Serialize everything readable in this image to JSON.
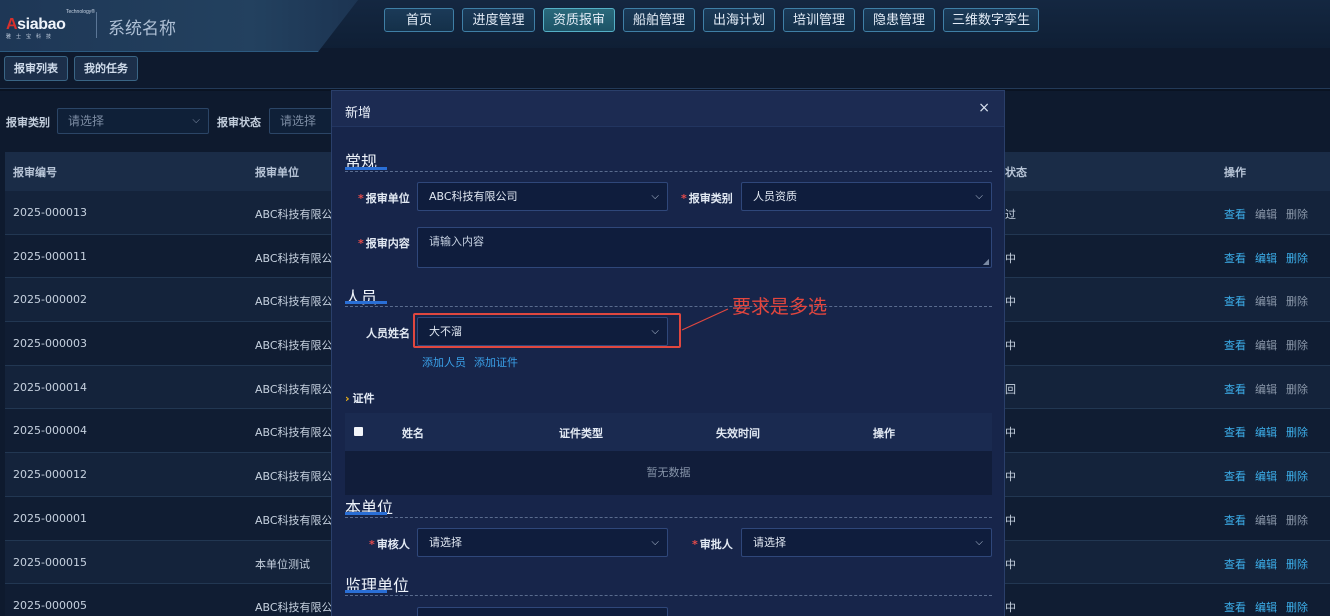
{
  "header": {
    "logo_text": "Asiabao",
    "logo_tag": "Technology®",
    "logo_sub": "雅士宝科技",
    "app_title": "系统名称",
    "nav": [
      {
        "label": "首页",
        "active": false
      },
      {
        "label": "进度管理",
        "active": false
      },
      {
        "label": "资质报审",
        "active": true
      },
      {
        "label": "船舶管理",
        "active": false
      },
      {
        "label": "出海计划",
        "active": false
      },
      {
        "label": "培训管理",
        "active": false
      },
      {
        "label": "隐患管理",
        "active": false
      },
      {
        "label": "三维数字孪生",
        "active": false
      }
    ]
  },
  "tabs": [
    {
      "label": "报审列表"
    },
    {
      "label": "我的任务"
    }
  ],
  "filters": {
    "type_label": "报审类别",
    "type_placeholder": "请选择",
    "status_label": "报审状态",
    "status_placeholder": "请选择"
  },
  "table": {
    "headers": {
      "id": "报审编号",
      "unit": "报审单位",
      "status": "状态",
      "actions": "操作"
    },
    "action_labels": {
      "view": "查看",
      "edit": "编辑",
      "del": "删除"
    },
    "rows": [
      {
        "id": "2025-000013",
        "unit": "ABC科技有限公",
        "status": "过",
        "edit_on": false,
        "del_on": false
      },
      {
        "id": "2025-000011",
        "unit": "ABC科技有限公",
        "status": "中",
        "edit_on": true,
        "del_on": true
      },
      {
        "id": "2025-000002",
        "unit": "ABC科技有限公",
        "status": "中",
        "edit_on": false,
        "del_on": false
      },
      {
        "id": "2025-000003",
        "unit": "ABC科技有限公",
        "status": "中",
        "edit_on": false,
        "del_on": false
      },
      {
        "id": "2025-000014",
        "unit": "ABC科技有限公",
        "status": "回",
        "edit_on": false,
        "del_on": false
      },
      {
        "id": "2025-000004",
        "unit": "ABC科技有限公",
        "status": "中",
        "edit_on": true,
        "del_on": true
      },
      {
        "id": "2025-000012",
        "unit": "ABC科技有限公",
        "status": "中",
        "edit_on": true,
        "del_on": true
      },
      {
        "id": "2025-000001",
        "unit": "ABC科技有限公",
        "status": "中",
        "edit_on": false,
        "del_on": false
      },
      {
        "id": "2025-000015",
        "unit": "本单位测试",
        "status": "中",
        "edit_on": true,
        "del_on": true
      },
      {
        "id": "2025-000005",
        "unit": "ABC科技有限公",
        "status": "中",
        "edit_on": true,
        "del_on": true
      }
    ]
  },
  "modal": {
    "title": "新增",
    "close": "×",
    "sections": {
      "general": "常规",
      "person": "人员",
      "own_unit": "本单位",
      "supervisor": "监理单位"
    },
    "fields": {
      "unit_label": "报审单位",
      "unit_value": "ABC科技有限公司",
      "category_label": "报审类别",
      "category_value": "人员资质",
      "content_label": "报审内容",
      "content_placeholder": "请输入内容",
      "person_label": "人员姓名",
      "person_value": "大不溜",
      "reviewer_label": "审核人",
      "reviewer_placeholder": "请选择",
      "approver_label": "审批人",
      "approver_placeholder": "请选择"
    },
    "links": {
      "add_person": "添加人员",
      "add_cert": "添加证件"
    },
    "cert": {
      "title": "证件",
      "headers": [
        "姓名",
        "证件类型",
        "失效时间",
        "操作"
      ],
      "empty": "暂无数据"
    }
  },
  "annotation": {
    "text": "要求是多选",
    "color": "#e3463e"
  }
}
